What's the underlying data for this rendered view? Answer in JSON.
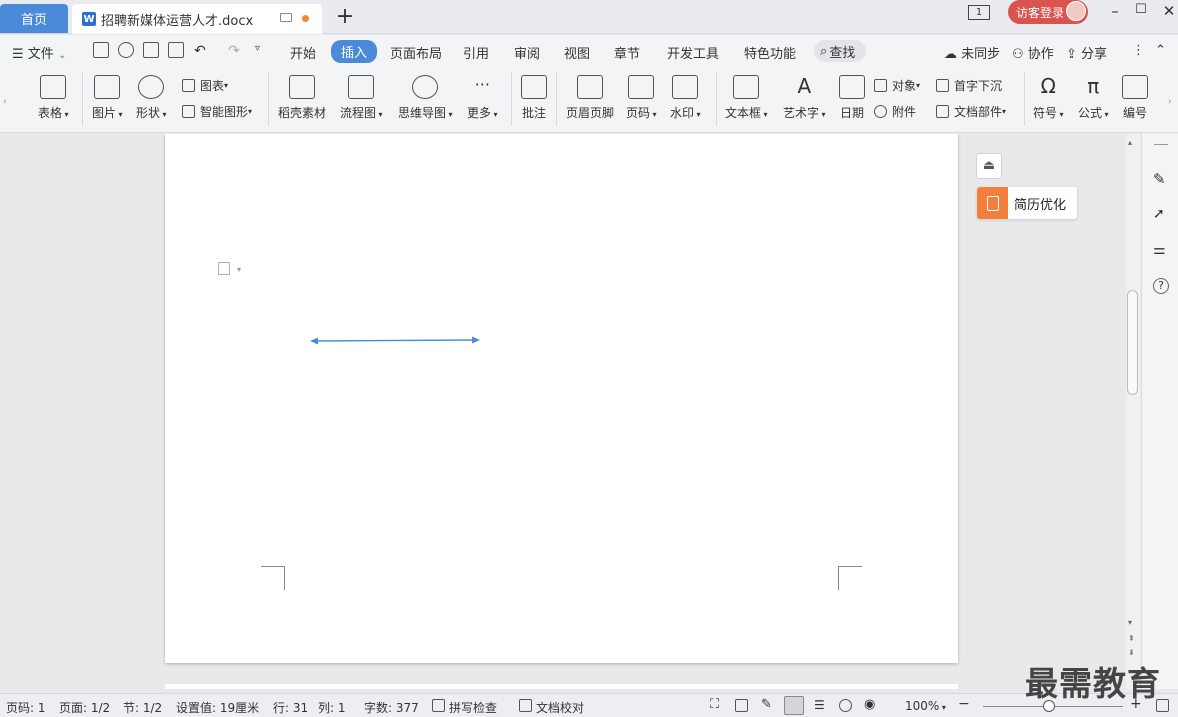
{
  "titlebar": {
    "home_tab": "首页",
    "doc_tab": "招聘新媒体运营人才.docx",
    "doc_icon": "W",
    "add_tab": "+",
    "window_badge": "1",
    "login_label": "访客登录",
    "min": "–",
    "max": "☐",
    "close": "✕"
  },
  "menubar": {
    "file": "文件",
    "tabs": [
      "开始",
      "插入",
      "页面布局",
      "引用",
      "审阅",
      "视图",
      "章节",
      "开发工具",
      "特色功能"
    ],
    "active_tab": "插入",
    "search": "查找",
    "sync": "未同步",
    "collab": "协作",
    "share": "分享"
  },
  "ribbon": {
    "table": "表格",
    "picture": "图片",
    "shape": "形状",
    "chart": "图表",
    "smart_shape": "智能图形",
    "material": "稻壳素材",
    "flowchart": "流程图",
    "mindmap": "思维导图",
    "more": "更多",
    "comment": "批注",
    "header_footer": "页眉页脚",
    "page_number": "页码",
    "watermark": "水印",
    "textbox": "文本框",
    "wordart": "艺术字",
    "date": "日期",
    "object": "对象",
    "attachment": "附件",
    "drop_cap": "首字下沉",
    "doc_parts": "文档部件",
    "symbol": "符号",
    "formula": "公式",
    "numbering": "编号"
  },
  "side_panel": {
    "resume_opt": "简历优化"
  },
  "statusbar": {
    "page_num": "页码: 1",
    "page": "页面: 1/2",
    "section": "节: 1/2",
    "setting": "设置值: 19厘米",
    "row": "行: 31",
    "col": "列: 1",
    "words": "字数: 377",
    "spell": "拼写检查",
    "proof": "文档校对",
    "zoom": "100%",
    "zoom_minus": "−",
    "zoom_plus": "+",
    "zoom_level": 0.43
  },
  "watermark": "最需教育",
  "colors": {
    "accent": "#4a8ad8",
    "login": "#d9534f",
    "resume": "#f2803c",
    "arrow": "#4a8ad8"
  }
}
